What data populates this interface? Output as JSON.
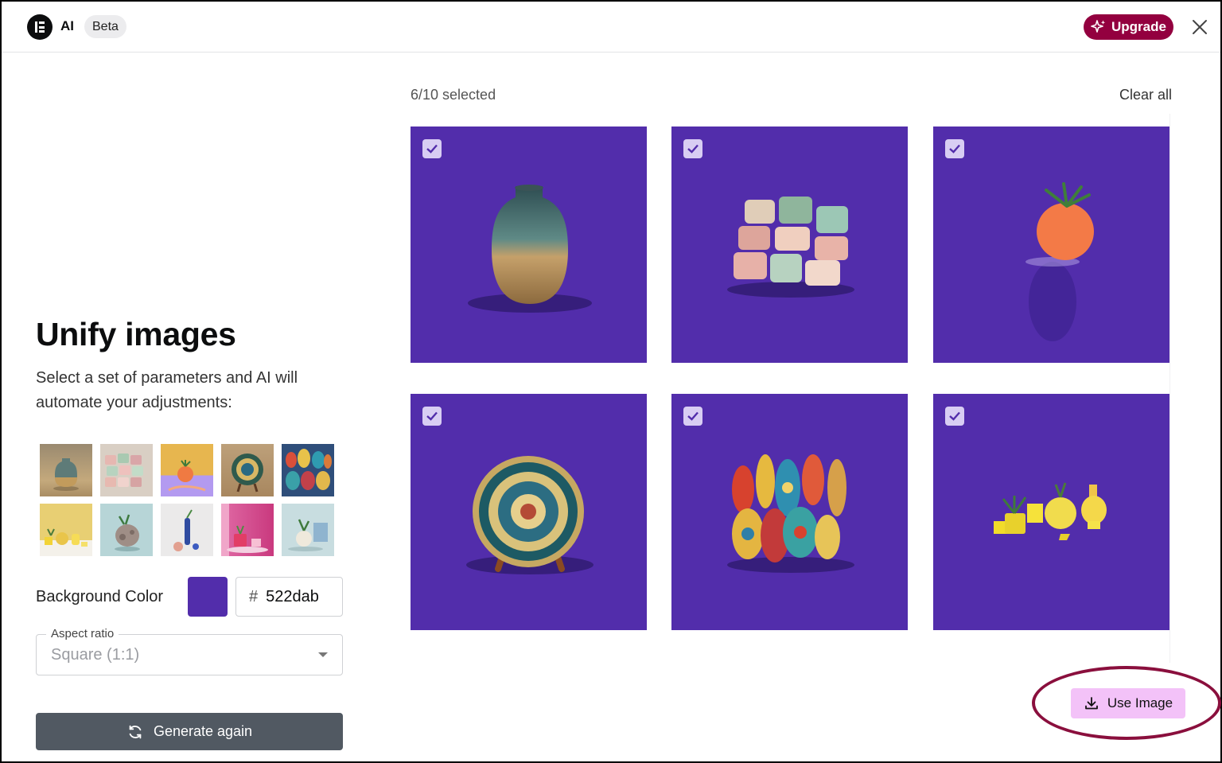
{
  "header": {
    "brand": "AI",
    "badge": "Beta",
    "upgrade_label": "Upgrade",
    "close_icon": "close-icon",
    "logo_icon": "elementor-logo"
  },
  "left": {
    "title": "Unify images",
    "description": "Select a set of parameters and AI will automate your adjustments:",
    "presets": [
      {
        "name": "vase-on-sand",
        "bg": "#b59c78"
      },
      {
        "name": "pastel-pots",
        "bg": "#d8cfc4"
      },
      {
        "name": "orange-pot-yellow",
        "bg": "#e5b552"
      },
      {
        "name": "plate-on-stand",
        "bg": "#c6a87d"
      },
      {
        "name": "painted-vases",
        "bg": "#3b5d8a"
      },
      {
        "name": "yellow-pots",
        "bg": "#e8cf73"
      },
      {
        "name": "stone-vase-blue",
        "bg": "#b9d7d8"
      },
      {
        "name": "blue-vase-white",
        "bg": "#e9e9ea"
      },
      {
        "name": "pink-pots",
        "bg": "#d85a99"
      },
      {
        "name": "vase-blue-blocks",
        "bg": "#c9dde0"
      }
    ],
    "bg_color_label": "Background Color",
    "bg_color_value": "#522dab",
    "hex_prefix": "#",
    "hex_value": "522dab",
    "aspect_label": "Aspect ratio",
    "aspect_value": "Square (1:1)",
    "generate_label": "Generate again"
  },
  "right": {
    "selected_text": "6/10 selected",
    "clear_all": "Clear all",
    "tiles": [
      {
        "subject": "ceramic-vase",
        "checked": true
      },
      {
        "subject": "stacked-cups",
        "checked": true
      },
      {
        "subject": "orange-planter",
        "checked": true
      },
      {
        "subject": "mosaic-plate",
        "checked": true
      },
      {
        "subject": "painted-vases",
        "checked": true
      },
      {
        "subject": "yellow-pots",
        "checked": true
      }
    ],
    "use_image_label": "Use Image"
  },
  "colors": {
    "accent": "#522dab",
    "upgrade": "#93003f",
    "use_image_bg": "#f3c2f8",
    "generate_bg": "#515962",
    "highlight_ring": "#8a0f3d"
  }
}
